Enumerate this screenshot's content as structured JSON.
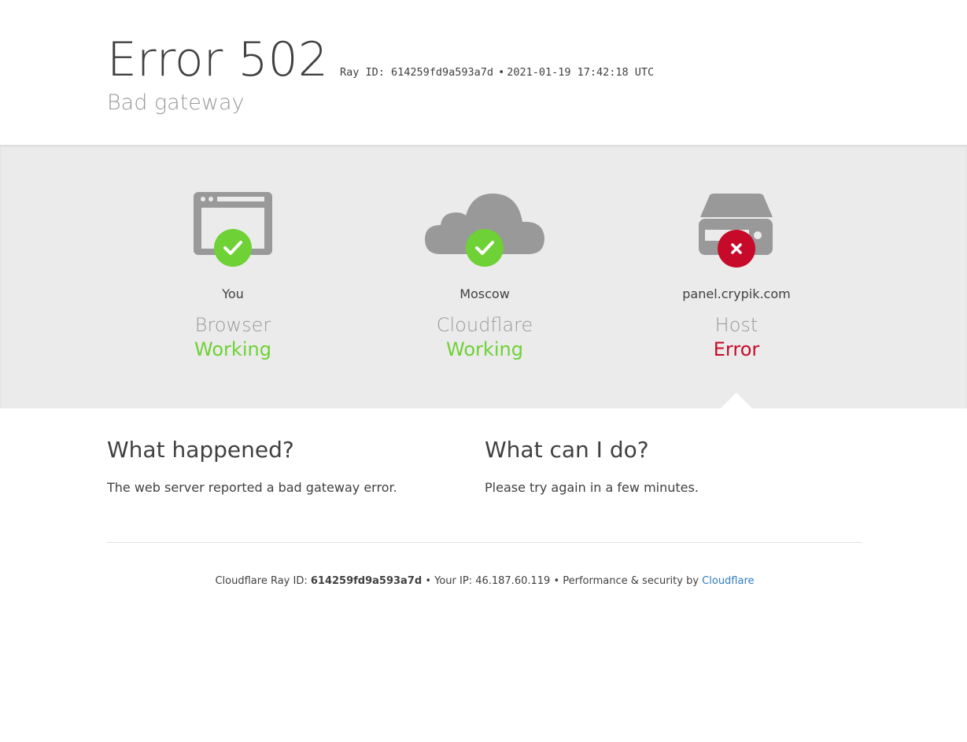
{
  "header": {
    "title": "Error 502",
    "ray_label": "Ray ID: 614259fd9a593a7d",
    "ray_sep": "•",
    "timestamp": "2021-01-19 17:42:18 UTC",
    "subtitle": "Bad gateway"
  },
  "nodes": [
    {
      "location": "You",
      "name": "Browser",
      "status": "Working",
      "state": "ok",
      "icon": "browser-icon"
    },
    {
      "location": "Moscow",
      "name": "Cloudflare",
      "status": "Working",
      "state": "ok",
      "icon": "cloud-icon"
    },
    {
      "location": "panel.crypik.com",
      "name": "Host",
      "status": "Error",
      "state": "error",
      "icon": "server-icon"
    }
  ],
  "info": {
    "what_happened_title": "What happened?",
    "what_happened_text": "The web server reported a bad gateway error.",
    "what_can_i_do_title": "What can I do?",
    "what_can_i_do_text": "Please try again in a few minutes."
  },
  "footer": {
    "ray_prefix": "Cloudflare Ray ID:",
    "ray_id": "614259fd9a593a7d",
    "sep": "•",
    "ip_text": "Your IP: 46.187.60.119",
    "perf_text": "Performance & security by",
    "link_text": "Cloudflare"
  },
  "colors": {
    "ok": "#6ed135",
    "error": "#c80a2a",
    "icon_gray": "#999999",
    "band": "#ebebeb",
    "link": "#2f7bbf"
  }
}
